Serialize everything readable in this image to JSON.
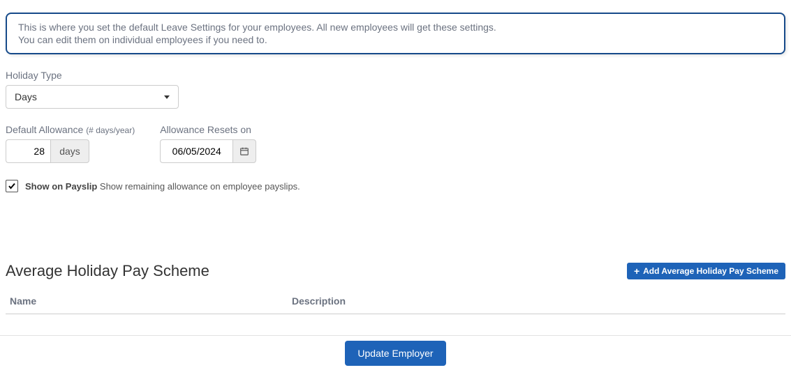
{
  "info": {
    "line1": "This is where you set the default Leave Settings for your employees. All new employees will get these settings.",
    "line2": "You can edit them on individual employees if you need to."
  },
  "holidayType": {
    "label": "Holiday Type",
    "value": "Days"
  },
  "defaultAllowance": {
    "label": "Default Allowance ",
    "sublabel": "(# days/year)",
    "value": "28",
    "unit": "days"
  },
  "allowanceResets": {
    "label": "Allowance Resets on",
    "value": "06/05/2024"
  },
  "showOnPayslip": {
    "checked": true,
    "boldLabel": "Show on Payslip",
    "description": " Show remaining allowance on employee payslips."
  },
  "scheme": {
    "title": "Average Holiday Pay Scheme",
    "addButton": "Add Average Holiday Pay Scheme",
    "columns": {
      "name": "Name",
      "description": "Description"
    }
  },
  "footer": {
    "updateButton": "Update Employer"
  }
}
